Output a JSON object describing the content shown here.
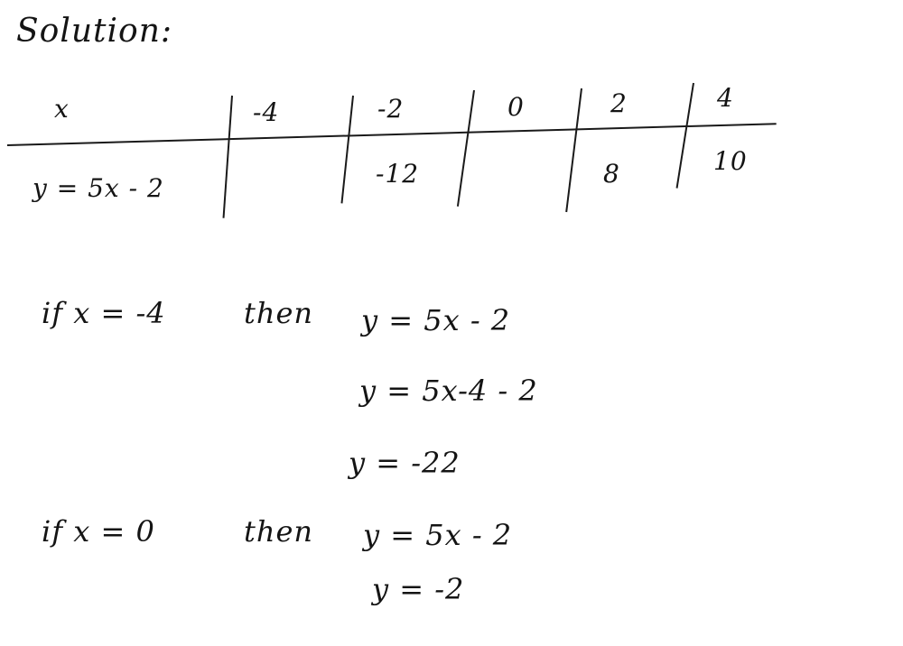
{
  "heading": "Solution:",
  "table": {
    "header_label": "x",
    "row_label": "y = 5x - 2",
    "x_values": [
      "-4",
      "-2",
      "0",
      "2",
      "4"
    ],
    "y_values": [
      "",
      "-12",
      "",
      "8",
      "10"
    ]
  },
  "work": [
    {
      "condition": "if x = -4",
      "then": "then",
      "steps": [
        "y = 5x - 2",
        "y = 5x-4 - 2",
        "y = -22"
      ]
    },
    {
      "condition": "if x = 0",
      "then": "then",
      "steps": [
        "y = 5x - 2",
        "y = -2"
      ]
    }
  ]
}
